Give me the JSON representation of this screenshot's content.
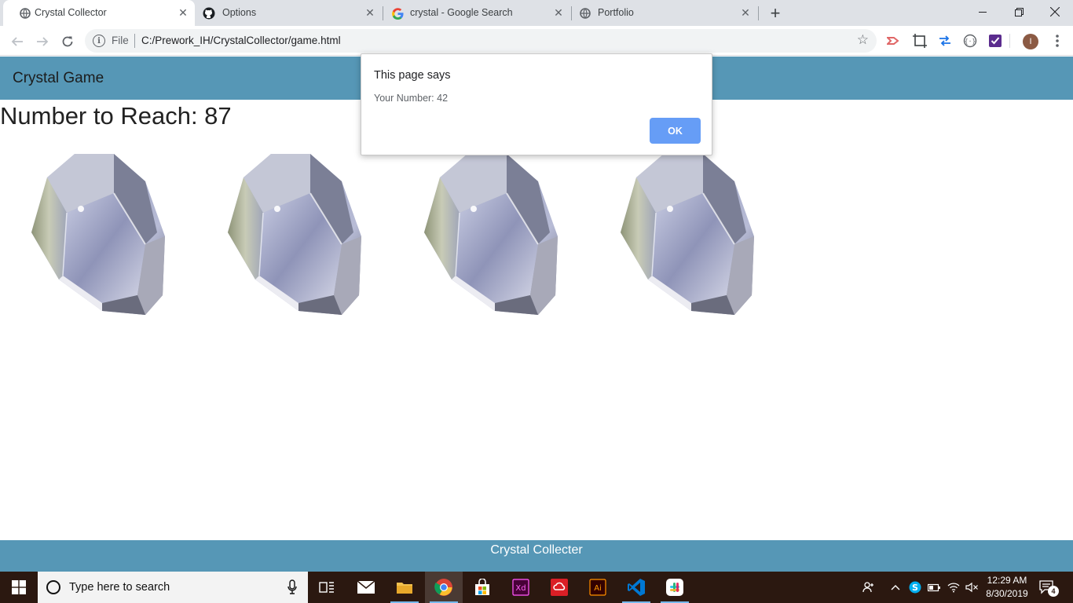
{
  "browser": {
    "tabs": [
      {
        "title": "Crystal Collector",
        "icon": "globe-icon",
        "active": true
      },
      {
        "title": "Options",
        "icon": "github-icon",
        "active": false
      },
      {
        "title": "crystal - Google Search",
        "icon": "google-icon",
        "active": false
      },
      {
        "title": "Portfolio",
        "icon": "globe-icon",
        "active": false
      }
    ],
    "address": {
      "scheme_label": "File",
      "url": "C:/Prework_IH/CrystalCollector/game.html"
    },
    "profile_initial": "I"
  },
  "page": {
    "brand": "Crystal Game",
    "target_label": "Number to Reach: 87",
    "crystals_count_shown": 4,
    "footer": "Crystal Collecter"
  },
  "dialog": {
    "title": "This page says",
    "message": "Your Number: 42",
    "ok_label": "OK"
  },
  "taskbar": {
    "search_placeholder": "Type here to search",
    "time": "12:29 AM",
    "date": "8/30/2019",
    "notification_count": "4",
    "apps": [
      "task-view-icon",
      "mail-icon",
      "file-explorer-icon",
      "chrome-icon",
      "store-icon",
      "adobe-xd-icon",
      "creative-cloud-icon",
      "illustrator-icon",
      "vscode-icon",
      "slack-icon"
    ]
  },
  "colors": {
    "header_bar": "#5697b6",
    "dialog_button": "#669df6",
    "taskbar": "#2b1810"
  }
}
